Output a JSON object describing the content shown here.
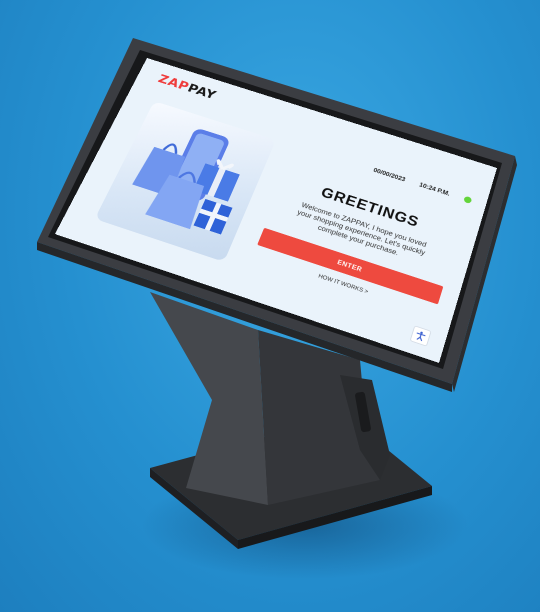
{
  "brand": {
    "part1": "ZAP",
    "part2": "PAY"
  },
  "header": {
    "date": "00/00/2023",
    "time": "10:24 P.M."
  },
  "main": {
    "title": "GREETINGS",
    "welcome_text": "Welcome to ZAPPAY, I hope you loved your shopping experience. Let's quickly complete your purchase.",
    "enter_label": "ENTER",
    "how_label": "HOW IT WORKS >"
  },
  "icons": {
    "status": "status-dot-icon",
    "accessibility": "accessibility-icon",
    "hero": "shopping-bags-gifts-illustration"
  },
  "colors": {
    "brand_red": "#ef3b3b",
    "enter_button": "#ee4a3f",
    "status_online": "#63d43a",
    "screen_bg": "#eaf3fb",
    "background": "#2590d0",
    "kiosk_body": "#3a3c40"
  }
}
